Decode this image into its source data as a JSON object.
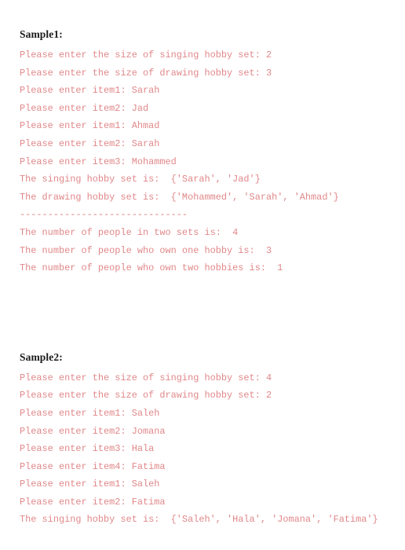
{
  "document": {
    "title": "Python set program sample output",
    "text_color": "#e1888a",
    "heading_color": "#1b1b1b",
    "background": "#ffffff"
  },
  "samples": [
    {
      "heading": "Sample1:",
      "lines": [
        "Please enter the size of singing hobby set: 2",
        "Please enter the size of drawing hobby set: 3",
        "Please enter item1: Sarah",
        "Please enter item2: Jad",
        "Please enter item1: Ahmad",
        "Please enter item2: Sarah",
        "Please enter item3: Mohammed",
        "The singing hobby set is:  {'Sarah', 'Jad'}",
        "The drawing hobby set is:  {'Mohammed', 'Sarah', 'Ahmad'}",
        "------------------------------",
        "The number of people in two sets is:  4",
        "The number of people who own one hobby is:  3",
        "The number of people who own two hobbies is:  1"
      ]
    },
    {
      "heading": "Sample2:",
      "lines": [
        "Please enter the size of singing hobby set: 4",
        "Please enter the size of drawing hobby set: 2",
        "Please enter item1: Saleh",
        "Please enter item2: Jomana",
        "Please enter item3: Hala",
        "Please enter item4: Fatima",
        "Please enter item1: Saleh",
        "Please enter item2: Fatima",
        "The singing hobby set is:  {'Saleh', 'Hala', 'Jomana', 'Fatima'}"
      ]
    }
  ]
}
